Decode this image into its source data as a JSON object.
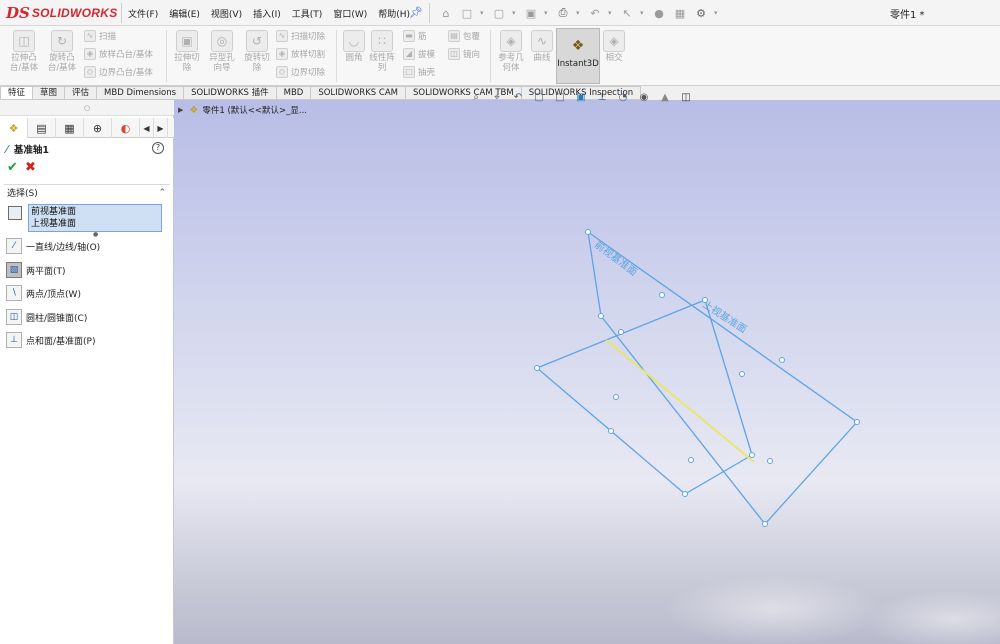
{
  "app": {
    "brand_mark": "DS",
    "brand_name": "SOLIDWORKS",
    "doc_title": "零件1 *"
  },
  "menu": [
    "文件(F)",
    "编辑(E)",
    "视图(V)",
    "插入(I)",
    "工具(T)",
    "窗口(W)",
    "帮助(H)"
  ],
  "quick_access": [
    "home-icon",
    "new-icon",
    "open-icon",
    "save-icon",
    "print-icon",
    "undo-icon",
    "select-icon",
    "rebuild-icon",
    "file-props-icon",
    "options-icon"
  ],
  "command_manager": {
    "big_buttons": [
      {
        "label": "拉伸凸\n台/基体",
        "icon": "extrude-boss-icon"
      },
      {
        "label": "旋转凸\n台/基体",
        "icon": "revolve-boss-icon"
      },
      {
        "label": "拉伸切\n除",
        "icon": "extrude-cut-icon"
      },
      {
        "label": "异型孔\n向导",
        "icon": "hole-wizard-icon"
      },
      {
        "label": "旋转切\n除",
        "icon": "revolve-cut-icon"
      },
      {
        "label": "圆角",
        "icon": "fillet-icon"
      },
      {
        "label": "线性阵\n列",
        "icon": "linear-pattern-icon"
      },
      {
        "label": "参考几\n何体",
        "icon": "ref-geometry-icon"
      },
      {
        "label": "曲线",
        "icon": "curves-icon"
      },
      {
        "label": "Instant3D",
        "icon": "instant3d-icon"
      },
      {
        "label": "相交",
        "icon": "intersect-icon"
      }
    ],
    "small_group1": [
      "扫描",
      "放样凸台/基体",
      "边界凸台/基体"
    ],
    "small_group2": [
      "扫描切除",
      "放样切割",
      "边界切除"
    ],
    "small_group3": [
      "筋",
      "拔模",
      "抽壳"
    ],
    "small_group4": [
      "包覆",
      "镜向"
    ]
  },
  "tabs": [
    "特征",
    "草图",
    "评估",
    "MBD Dimensions",
    "SOLIDWORKS 插件",
    "MBD",
    "SOLIDWORKS CAM",
    "SOLIDWORKS CAM TBM",
    "SOLIDWORKS Inspection"
  ],
  "panel": {
    "title": "基准轴1",
    "section_title": "选择(S)",
    "selections": [
      "前视基准面",
      "上视基准面"
    ],
    "options": [
      {
        "label": "一直线/边线/轴(O)",
        "icon": "line-edge-axis-icon",
        "selected": false
      },
      {
        "label": "两平面(T)",
        "icon": "two-planes-icon",
        "selected": true
      },
      {
        "label": "两点/顶点(W)",
        "icon": "two-points-icon",
        "selected": false
      },
      {
        "label": "圆柱/圆锥面(C)",
        "icon": "cylinder-cone-icon",
        "selected": false
      },
      {
        "label": "点和面/基准面(P)",
        "icon": "point-plane-icon",
        "selected": false
      }
    ]
  },
  "viewport": {
    "tree_item": "零件1  (默认<<默认>_显...",
    "plane_labels": [
      "前视基准面",
      "上视基准面"
    ],
    "colors": {
      "plane_edge": "#5fa3e6",
      "axis": "#e8e860"
    }
  }
}
